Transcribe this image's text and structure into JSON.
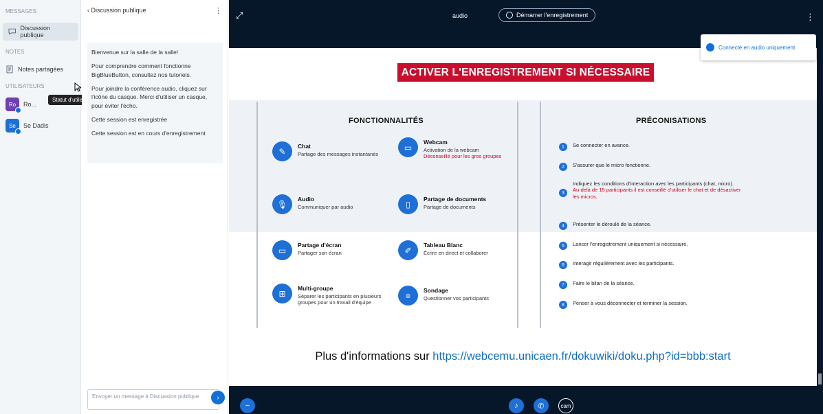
{
  "userlist": {
    "messages_heading": "MESSAGES",
    "public_chat": "Discussion publique",
    "notes_heading": "NOTES",
    "shared_notes": "Notes partagées",
    "users_heading": "UTILISATEURS",
    "users": [
      {
        "initials": "Ro",
        "name": "Ro...",
        "color": "#6f3fb3"
      },
      {
        "initials": "Se",
        "name": "Se Dadis",
        "color": "#1e6fd6"
      }
    ],
    "tooltip": "Statut d'utilisateur"
  },
  "chat": {
    "back_label": "‹ Discussion publique",
    "more_icon": "more-vertical-icon",
    "messages": [
      "Bienvenue sur la salle de la salle!",
      "Pour comprendre comment fonctionne BigBlueButton, consultez nos tutoriels.",
      "Pour joindre la conférence audio, cliquez sur l'icône du casque. Merci d'utiliser un casque, pour éviter l'écho.",
      "Cette session est enregistrée",
      "Cette session est en cours d'enregistrement"
    ],
    "input_placeholder": "Envoyer un message à Discussion publique",
    "send_icon": "send-icon"
  },
  "topbar": {
    "users_toggle_icon": "users-icon",
    "title": "audio",
    "recording_label": "Démarrer l'enregistrement",
    "more_icon": "more-vertical-icon"
  },
  "connection": {
    "label": "Connecté en audio uniquement"
  },
  "slide": {
    "banner": "ACTIVER L'ENREGISTREMENT SI NÉCESSAIRE",
    "left_title": "FONCTIONNALITÉS",
    "right_title": "PRÉCONISATIONS",
    "features": [
      {
        "title": "Chat",
        "desc": "Partage des messages instantanés",
        "warn": "",
        "icon": "chat-icon"
      },
      {
        "title": "Webcam",
        "desc": "Activation de la webcam",
        "warn": "Déconseillé pour les gros groupes",
        "icon": "webcam-icon"
      },
      {
        "title": "Audio",
        "desc": "Communiquer par audio",
        "warn": "",
        "icon": "microphone-icon"
      },
      {
        "title": "Partage de documents",
        "desc": "Partage de documents",
        "warn": "",
        "icon": "document-icon"
      },
      {
        "title": "Partage d'écran",
        "desc": "Partager son écran",
        "warn": "",
        "icon": "screen-share-icon"
      },
      {
        "title": "Tableau Blanc",
        "desc": "Écrire en direct et collaborer",
        "warn": "",
        "icon": "whiteboard-icon"
      },
      {
        "title": "Multi-groupe",
        "desc": "Séparer les participants en plusieurs groupes pour un travail d'équipe",
        "warn": "",
        "icon": "breakout-icon"
      },
      {
        "title": "Sondage",
        "desc": "Questionner vos participants",
        "warn": "",
        "icon": "poll-icon"
      }
    ],
    "recommendations": [
      {
        "num": "1",
        "text": "Se connecter en avance.",
        "warn": ""
      },
      {
        "num": "2",
        "text": "S'assurer que le micro fonctionne.",
        "warn": ""
      },
      {
        "num": "3",
        "text": "Indiquez les conditions d'interaction avec les participants (chat, micro).",
        "warn": "Au-delà de 15 participants il est conseillé d'utiliser le chat et de désactiver les micros."
      },
      {
        "num": "4",
        "text": "Présenter le déroulé de la séance.",
        "warn": ""
      },
      {
        "num": "5",
        "text": "Lancer l'enregistrement uniquement si nécessaire.",
        "warn": ""
      },
      {
        "num": "6",
        "text": "Interagir régulièrement avec les participants.",
        "warn": ""
      },
      {
        "num": "7",
        "text": "Faire le bilan de la séance.",
        "warn": ""
      },
      {
        "num": "8",
        "text": "Penser à vous déconnecter et terminer la session.",
        "warn": ""
      }
    ],
    "info_prefix": "Plus d'informations sur ",
    "info_link": "https://webcemu.unicaen.fr/dokuwiki/doku.php?id=bbb:start"
  },
  "bottombar": {
    "actions_icon": "plus-icon",
    "mic_icon": "microphone-icon",
    "audio_icon": "phone-icon",
    "cam_label": "cam"
  },
  "colors": {
    "accent": "#1e6fd6",
    "banner": "#c8102e",
    "stage_bg": "#06172a",
    "warning_text": "#d0021b"
  }
}
